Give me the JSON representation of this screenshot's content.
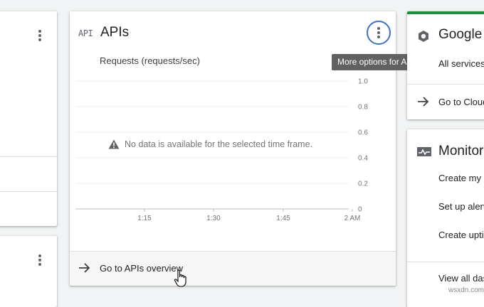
{
  "apis_card": {
    "icon_text": "API",
    "title": "APIs",
    "more_tooltip": "More options for APIs",
    "chart_label": "Requests (requests/sec)",
    "no_data": "No data is available for the selected time frame.",
    "footer_link": "Go to APIs overview"
  },
  "chart_data": {
    "type": "line",
    "title": "",
    "ylabel": "",
    "ylim": [
      0,
      1.0
    ],
    "y_ticks": [
      "1.0",
      "0.8",
      "0.6",
      "0.4",
      "0.2",
      "0"
    ],
    "x_ticks": [
      "1:15",
      "1:30",
      "1:45",
      "2 AM"
    ],
    "series": []
  },
  "cloud_card": {
    "title": "Google C",
    "subtitle": "All services",
    "link": "Go to Cloud",
    "accent": "#1e8e3e"
  },
  "monitoring_card": {
    "title": "Monitori",
    "items": [
      "Create my c",
      "Set up alert",
      "Create uptim",
      "View all das"
    ]
  },
  "colors": {
    "focus_ring": "#3b6fc9",
    "tooltip_bg": "#616161",
    "background": "#f1f3f4"
  },
  "watermark": "wsxdn.com"
}
